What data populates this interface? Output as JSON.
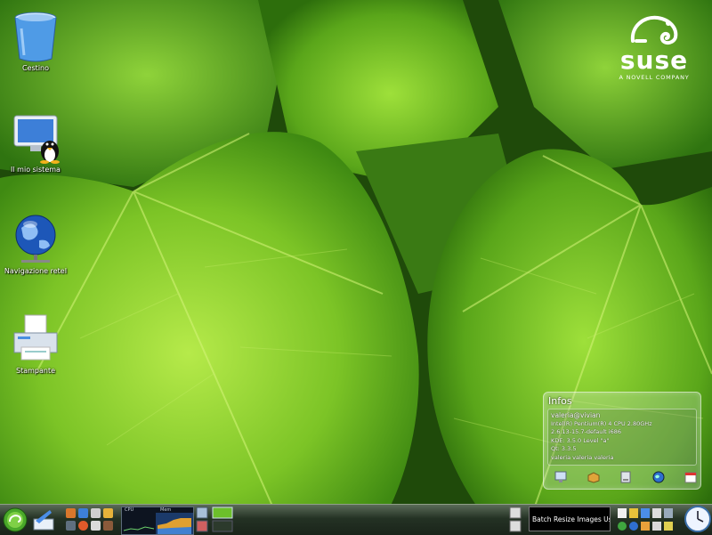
{
  "desktop": {
    "icons": [
      {
        "label": "Cestino",
        "icon": "trash-icon"
      },
      {
        "label": "Il mio sistema",
        "icon": "my-computer-icon"
      },
      {
        "label": "Navigazione reteI",
        "icon": "network-globe-icon"
      },
      {
        "label": "Stampante",
        "icon": "printer-icon"
      }
    ]
  },
  "branding": {
    "logo_word": "suse",
    "logo_tagline": "A NOVELL COMPANY"
  },
  "infos_widget": {
    "title": "Infos",
    "user": "valeria@vivian",
    "lines": [
      "Intel(R) Pentium(R) 4 CPU 2.80GHz",
      "2.6.13-15.7-default i686",
      "KDE: 3.5.0 Level \"a\"",
      "Qt: 3.3.5",
      "valeria valeria valeria"
    ],
    "tray_icons": [
      "monitor-icon",
      "package-icon",
      "drive-icon",
      "globe-icon",
      "calendar-icon"
    ]
  },
  "taskbar": {
    "start_icon": "suse-chameleon-icon",
    "cpu_monitor_labels": [
      "CPU",
      "Mem"
    ],
    "task_button_label": "Batch Resize Images Usin",
    "colors": {
      "bar_dark": "#1a241a",
      "accent": "#6bbf2a"
    }
  }
}
